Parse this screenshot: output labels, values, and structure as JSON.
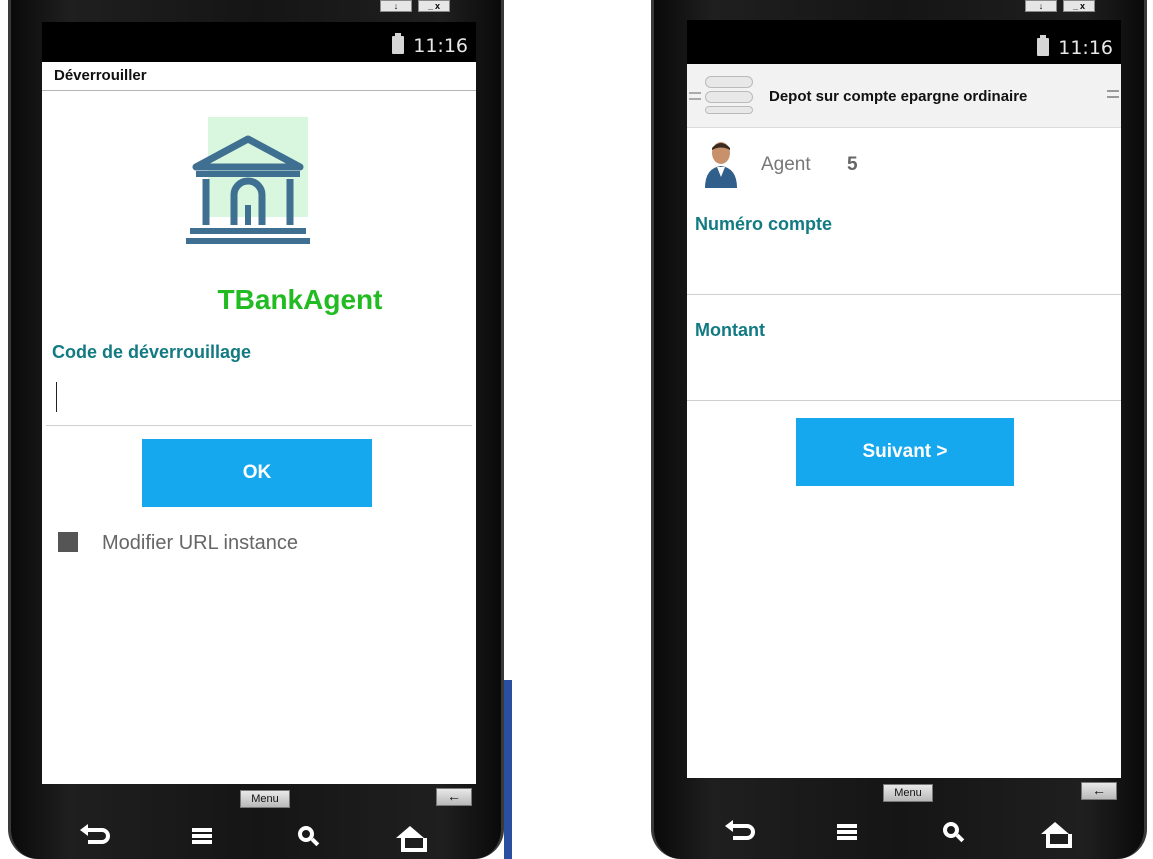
{
  "left_phone": {
    "window_controls": {
      "restore": "↓",
      "minimize": "_",
      "close": "x"
    },
    "status_bar": {
      "time": "11:16"
    },
    "title": "Déverrouiller",
    "app_name": "TBankAgent",
    "unlock_label": "Code de déverrouillage",
    "unlock_value": "",
    "ok_label": "OK",
    "checkbox_label": "Modifier URL instance",
    "soft_keys": {
      "menu": "Menu",
      "back": "←"
    }
  },
  "right_phone": {
    "window_controls": {
      "restore": "↓",
      "minimize": "_",
      "close": "x"
    },
    "status_bar": {
      "time": "11:16"
    },
    "action_title": "Depot sur compte epargne ordinaire",
    "agent_label": "Agent",
    "agent_value": "5",
    "account_label": "Numéro compte",
    "account_value": "",
    "amount_label": "Montant",
    "amount_value": "",
    "next_label": "Suivant >",
    "soft_keys": {
      "menu": "Menu",
      "back": "←"
    }
  },
  "colors": {
    "accent_button": "#15a8ee",
    "label_teal": "#127a82",
    "app_name_green": "#22bb22",
    "logo_blue": "#3f6f91",
    "logo_bg_green": "#d9f7de"
  },
  "icons": [
    "bank-icon",
    "battery-icon",
    "agent-avatar-icon",
    "drawer-menu-icon",
    "back-icon",
    "menu-icon",
    "search-icon",
    "home-icon"
  ]
}
